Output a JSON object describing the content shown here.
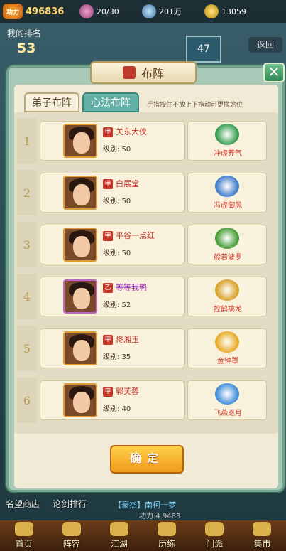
{
  "topbar": {
    "power_label": "功力",
    "power": "496836",
    "stamina": "20/30",
    "silver": "201万",
    "gold": "13059"
  },
  "rank": {
    "label": "我的排名",
    "value": "53"
  },
  "flag_value": "47",
  "return_label": "返回",
  "dialog": {
    "title": "布阵",
    "close_label": "✕",
    "tabs": [
      {
        "label": "弟子布阵",
        "active": false
      },
      {
        "label": "心法布阵",
        "active": true
      }
    ],
    "hint": "手指按住不放上下拖动可更换站位",
    "confirm_label": "确定"
  },
  "rows": [
    {
      "num": "1",
      "grade": "甲",
      "name": "关东大侠",
      "level": "级别: 50",
      "skill": "冲虚养气",
      "skill_color": "#2f9a4a",
      "portrait": "orange"
    },
    {
      "num": "2",
      "grade": "甲",
      "name": "白展堂",
      "level": "级别: 50",
      "skill": "冯虚御风",
      "skill_color": "#3a78c8",
      "portrait": "orange"
    },
    {
      "num": "3",
      "grade": "甲",
      "name": "平谷一点红",
      "level": "级别: 50",
      "skill": "般若波罗",
      "skill_color": "#3f9a2f",
      "portrait": "orange"
    },
    {
      "num": "4",
      "grade": "乙",
      "name": "等等我鸭",
      "level": "级别: 52",
      "skill": "控鹤擒龙",
      "skill_color": "#d8a020",
      "portrait": "purple"
    },
    {
      "num": "5",
      "grade": "甲",
      "name": "佟湘玉",
      "level": "级别: 35",
      "skill": "金钟罩",
      "skill_color": "#e8a820",
      "portrait": "orange"
    },
    {
      "num": "6",
      "grade": "甲",
      "name": "郭芙蓉",
      "level": "级别: 40",
      "skill": "飞燕逐月",
      "skill_color": "#3a8ad8",
      "portrait": "orange"
    }
  ],
  "bottom": {
    "reputation_shop": "名望商店",
    "sword_rank": "论剑排行",
    "marquee": "【豪杰】南柯一梦",
    "marquee_sub": "功力:4.9483"
  },
  "nav": [
    {
      "label": "首页",
      "icon": "home-icon"
    },
    {
      "label": "阵容",
      "icon": "lineup-icon"
    },
    {
      "label": "江湖",
      "icon": "world-icon"
    },
    {
      "label": "历练",
      "icon": "training-icon"
    },
    {
      "label": "门派",
      "icon": "sect-icon"
    },
    {
      "label": "集市",
      "icon": "market-icon"
    }
  ]
}
